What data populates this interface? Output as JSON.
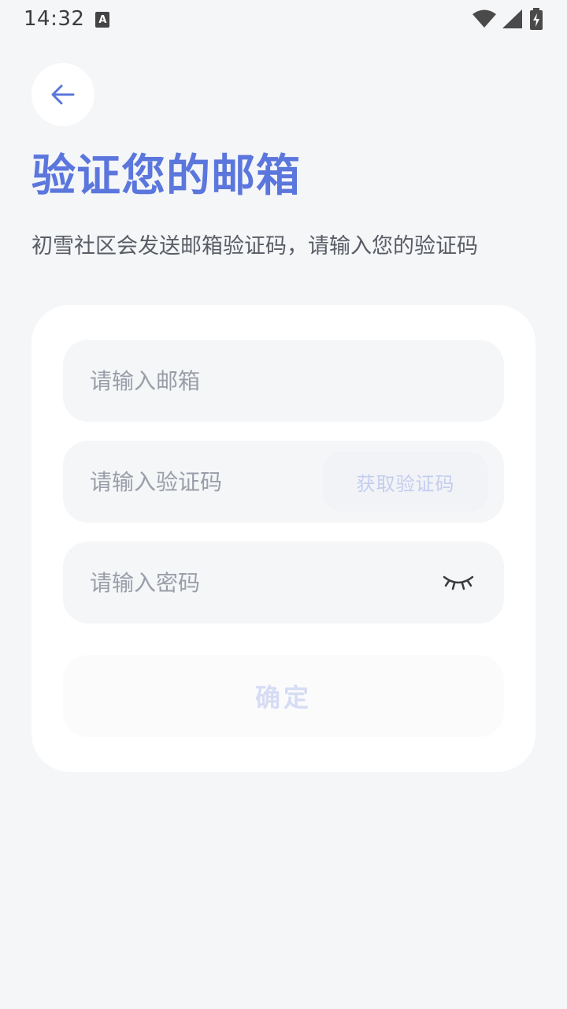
{
  "status_bar": {
    "time": "14:32",
    "notification_badge": "A"
  },
  "header": {
    "back_icon": "arrow-left-icon",
    "title": "验证您的邮箱",
    "subtitle": "初雪社区会发送邮箱验证码，请输入您的验证码"
  },
  "form": {
    "email_placeholder": "请输入邮箱",
    "code_placeholder": "请输入验证码",
    "get_code_label": "获取验证码",
    "password_placeholder": "请输入密码",
    "password_toggle_icon": "eye-closed-icon",
    "confirm_label": "确定"
  },
  "colors": {
    "accent": "#5b76dc",
    "background": "#f4f6f8",
    "card": "#ffffff",
    "disabled_text": "#d6dcf3"
  }
}
